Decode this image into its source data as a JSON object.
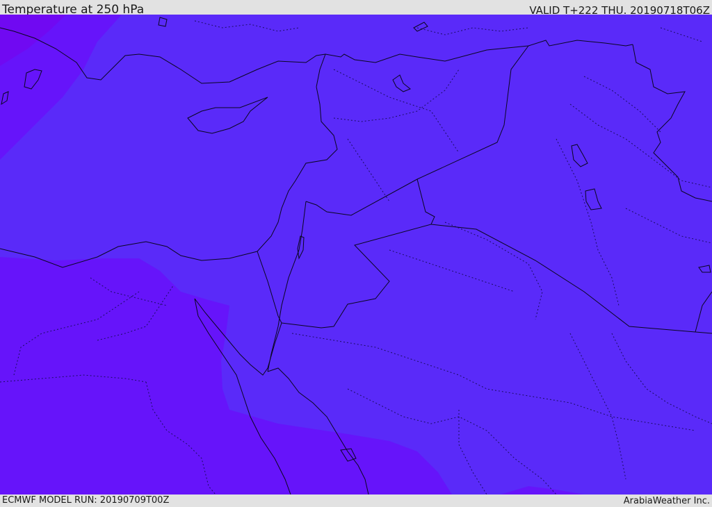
{
  "header": {
    "title": "Temperature at 250 hPa",
    "valid": "VALID T+222 THU. 20190718T06Z"
  },
  "footer": {
    "model_run": "ECMWF MODEL RUN: 20190709T00Z",
    "credit": "ArabiaWeather Inc."
  },
  "colors": {
    "main_field": "#5a2af9",
    "warm_south": "#6614fa",
    "warm_northwest": "#6e0cf5",
    "border": "#0a0620",
    "header_bg": "#e2e2e2"
  }
}
